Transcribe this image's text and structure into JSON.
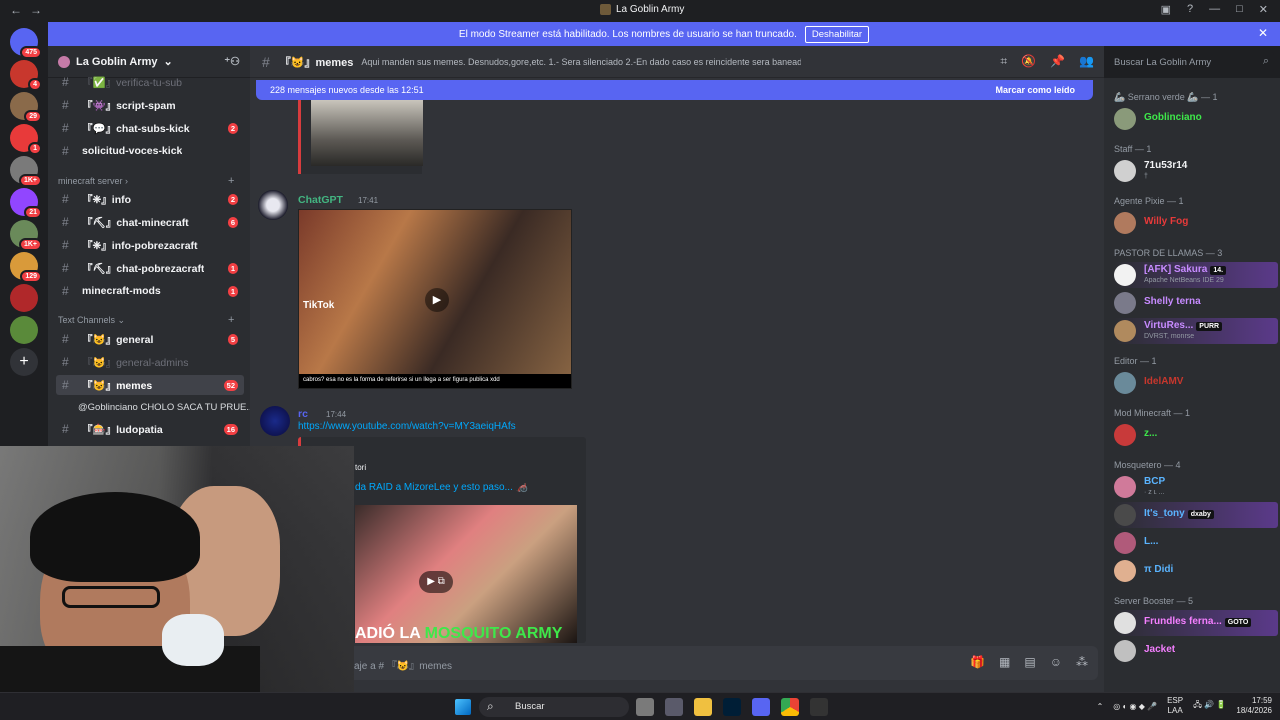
{
  "window": {
    "title": "La Goblin Army"
  },
  "banner": {
    "text": "El modo Streamer está habilitado. Los nombres de usuario se han truncado.",
    "button": "Deshabilitar"
  },
  "servers": [
    {
      "badge": "475",
      "color": "#5865f2"
    },
    {
      "badge": "4",
      "color": "#c8372d"
    },
    {
      "badge": "29",
      "color": "#8a6a4a"
    },
    {
      "badge": "1",
      "color": "#e83a3a"
    },
    {
      "badge": "1K+",
      "color": "#7a7a7a"
    },
    {
      "badge": "21",
      "color": "#9146ff"
    },
    {
      "badge": "1K+",
      "color": "#6a8a5a"
    },
    {
      "badge": "129",
      "color": "#d99a3a"
    },
    {
      "badge": "",
      "color": "#b0282a"
    },
    {
      "badge": "",
      "color": "#5a8a3a"
    }
  ],
  "guild": {
    "name": "La Goblin Army"
  },
  "channels": [
    {
      "label": "『✅』verifica-tu-sub",
      "count": "",
      "state": "muted"
    },
    {
      "label": "『👾』script-spam",
      "count": "",
      "state": "unread"
    },
    {
      "label": "『💬』chat-subs-kick",
      "count": "2",
      "state": "unread"
    },
    {
      "label": "solicitud-voces-kick",
      "count": "",
      "state": "unread"
    }
  ],
  "categories": {
    "minecraft": "minecraft server",
    "text": "Text Channels"
  },
  "minecraft_channels": [
    {
      "label": "『❈』info",
      "count": "2"
    },
    {
      "label": "『⛏』chat-minecraft",
      "count": "6"
    },
    {
      "label": "『❈』info-pobrezacraft",
      "count": ""
    },
    {
      "label": "『⛏』chat-pobrezacraft",
      "count": "1"
    },
    {
      "label": "minecraft-mods",
      "count": "1"
    }
  ],
  "text_channels": [
    {
      "label": "『😺』general",
      "count": "5",
      "state": "unread"
    },
    {
      "label": "『😺』general-admins",
      "count": "",
      "state": "muted"
    },
    {
      "label": "『😺』memes",
      "count": "52",
      "state": "active"
    }
  ],
  "thread": "@Goblinciano CHOLO SACA TU PRUE...",
  "extra_channel": {
    "label": "『🎰』ludopatia",
    "count": "16"
  },
  "topbar": {
    "channel": "『😺』memes",
    "topic": "Aqui manden sus memes. Desnudos,gore,etc. 1.- Sera silenciado 2.-En dado caso es reincidente sera baneado"
  },
  "search": {
    "placeholder": "Buscar La Goblin Army"
  },
  "newbar": {
    "text": "228 mensajes nuevos desde las 12:51",
    "mark": "Marcar como leído"
  },
  "messages": [
    {
      "user": "ChatGPT",
      "time": "17:41",
      "color": "#43b581",
      "tiktok": "TikTok",
      "caption": "cabros? esa no es la forma de referirse si un llega a ser figura publica xdd"
    },
    {
      "user": "rc",
      "time": "17:44",
      "color": "#5865f2",
      "link": "https://www.youtube.com/watch?v=MY3aeiqHAfs"
    }
  ],
  "embed": {
    "author": "tori",
    "title": "da RAID a MizoreLee y esto paso... 🦽",
    "thumb_text_a": "ADIÓ LA ",
    "thumb_text_b": "MOSQUITO ARMY"
  },
  "composer": {
    "placeholder": "aje a # 『😺』memes"
  },
  "member_groups": [
    {
      "label": "🦾 Serrano verde 🦾 — 1",
      "members": [
        {
          "name": "Goblinciano",
          "color": "#3ee84a",
          "sub": ""
        }
      ]
    },
    {
      "label": "Staff — 1",
      "members": [
        {
          "name": "71u53r14",
          "color": "#f2f3f5",
          "sub": "†"
        }
      ]
    },
    {
      "label": "Agente Pixie — 1",
      "members": [
        {
          "name": "Willy Fog",
          "color": "#e83a3a",
          "sub": ""
        }
      ]
    },
    {
      "label": "PASTOR DE LLAMAS — 3",
      "members": [
        {
          "name": "[AFK] Sakura",
          "color": "#c78bff",
          "sub": "Apache NetBeans IDE 29",
          "tag": "14."
        },
        {
          "name": "Shelly terna",
          "color": "#c78bff",
          "sub": ""
        },
        {
          "name": "VirtuRes...",
          "color": "#c78bff",
          "sub": "DVRST, monrse",
          "tag": "PURR"
        }
      ]
    },
    {
      "label": "Editor — 1",
      "members": [
        {
          "name": "IdelAMV",
          "color": "#c8372d",
          "sub": ""
        }
      ]
    },
    {
      "label": "Mod Minecraft — 1",
      "members": [
        {
          "name": "z...",
          "color": "#3ee84a",
          "sub": ""
        }
      ]
    },
    {
      "label": "Mosquetero — 4",
      "members": [
        {
          "name": "BCP",
          "color": "#5ab4ff",
          "sub": "· z ʟ ..."
        },
        {
          "name": "It's_tony",
          "color": "#5ab4ff",
          "sub": "",
          "tag": "dxaby"
        },
        {
          "name": "L...",
          "color": "#5ab4ff",
          "sub": ""
        },
        {
          "name": "π Didi",
          "color": "#5ab4ff",
          "sub": ""
        }
      ]
    },
    {
      "label": "Server Booster — 5",
      "members": [
        {
          "name": "Frundles ferna...",
          "color": "#f47fff",
          "sub": "",
          "tag": "GOTO"
        },
        {
          "name": "Jacket",
          "color": "#f47fff",
          "sub": ""
        }
      ]
    }
  ],
  "taskbar": {
    "search": "Buscar",
    "lang1": "ESP",
    "lang2": "LAA",
    "time": "17:59",
    "date": "18/4/2026"
  }
}
